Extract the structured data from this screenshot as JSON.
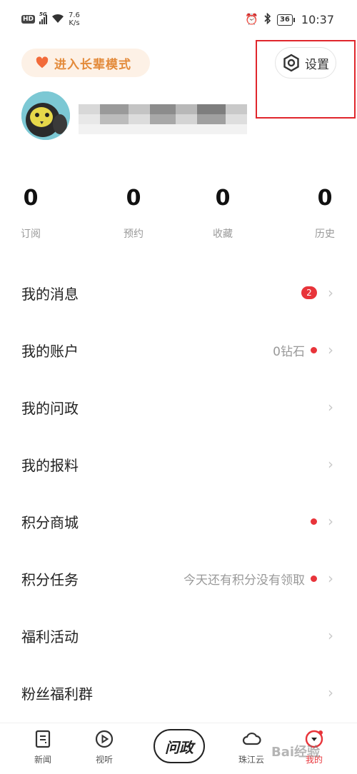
{
  "status_bar": {
    "hd": "HD",
    "network": "5G",
    "speed_value": "7.6",
    "speed_unit": "K/s",
    "battery": "36",
    "time": "10:37"
  },
  "header": {
    "elder_mode_label": "进入长辈模式",
    "settings_label": "设置"
  },
  "stats": [
    {
      "value": "0",
      "label": "订阅"
    },
    {
      "value": "0",
      "label": "预约"
    },
    {
      "value": "0",
      "label": "收藏"
    },
    {
      "value": "0",
      "label": "历史"
    }
  ],
  "menu": {
    "items": [
      {
        "label": "我的消息",
        "badge": "2"
      },
      {
        "label": "我的账户",
        "extra": "0钻石"
      },
      {
        "label": "我的问政"
      },
      {
        "label": "我的报料"
      },
      {
        "label": "积分商城"
      },
      {
        "label": "积分任务",
        "extra": "今天还有积分没有领取"
      },
      {
        "label": "福利活动"
      },
      {
        "label": "粉丝福利群"
      }
    ]
  },
  "tab_bar": {
    "tabs": [
      {
        "label": "新闻",
        "icon": "news-icon"
      },
      {
        "label": "视听",
        "icon": "play-icon"
      },
      {
        "label": "问政",
        "icon": "wenzheng-logo"
      },
      {
        "label": "珠江云",
        "icon": "cloud-icon"
      },
      {
        "label": "我的",
        "icon": "profile-icon"
      }
    ],
    "active": "我的"
  },
  "colors": {
    "accent_red": "#e8343a",
    "elder_orange": "#e38a3a",
    "elder_bg": "#fdf1e6",
    "highlight_box": "#e0262c"
  },
  "watermark": "Bai经验"
}
